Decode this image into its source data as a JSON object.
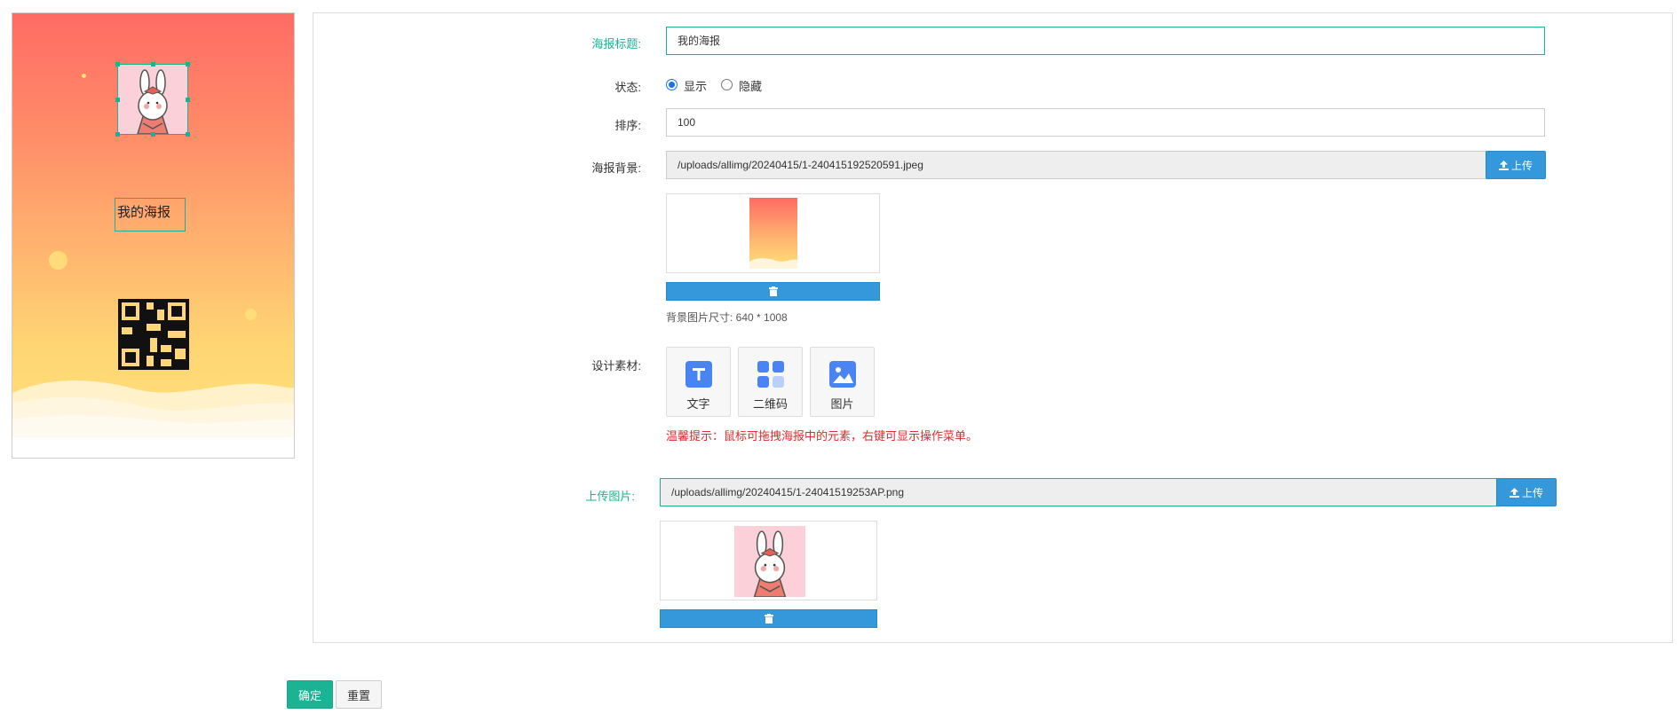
{
  "poster": {
    "title_text": "我的海报"
  },
  "form": {
    "title_label": "海报标题:",
    "title_value": "我的海报",
    "status_label": "状态:",
    "status_options": [
      "显示",
      "隐藏"
    ],
    "status_selected": "显示",
    "sort_label": "排序:",
    "sort_value": "100",
    "bg_label": "海报背景:",
    "bg_path": "/uploads/allimg/20240415/1-240415192520591.jpeg",
    "upload_label": "上传",
    "bg_size_hint": "背景图片尺寸: 640 * 1008",
    "materials_label": "设计素材:",
    "materials": [
      {
        "label": "文字",
        "icon": "text-icon"
      },
      {
        "label": "二维码",
        "icon": "qrcode-icon"
      },
      {
        "label": "图片",
        "icon": "image-icon"
      }
    ],
    "tip": "温馨提示：鼠标可拖拽海报中的元素，右键可显示操作菜单。",
    "image_label": "上传图片:",
    "image_path": "/uploads/allimg/20240415/1-24041519253AP.png"
  },
  "actions": {
    "confirm": "确定",
    "reset": "重置"
  },
  "colors": {
    "accent": "#19b394",
    "primary": "#3498db",
    "tip": "#e52a2a"
  }
}
